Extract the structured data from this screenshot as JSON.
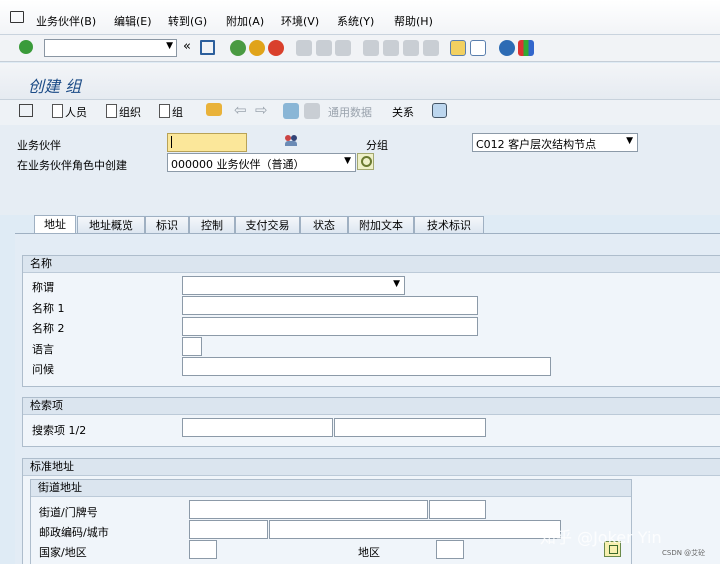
{
  "menubar": {
    "items": [
      "业务伙伴(B)",
      "编辑(E)",
      "转到(G)",
      "附加(A)",
      "环境(V)",
      "系统(Y)",
      "帮助(H)"
    ]
  },
  "page": {
    "title": "创建 组"
  },
  "toolbar": {
    "person": "人员",
    "organization": "组织",
    "group": "组",
    "data_transfer": "通用数据",
    "relationships": "关系"
  },
  "header_form": {
    "partner_label": "业务伙伴",
    "partner_value": "",
    "grouping_label": "分组",
    "grouping_value": "C012 客户层次结构节点",
    "role_label": "在业务伙伴角色中创建",
    "role_value": "000000 业务伙伴（普通）"
  },
  "tabs": [
    "地址",
    "地址概览",
    "标识",
    "控制",
    "支付交易",
    "状态",
    "附加文本",
    "技术标识"
  ],
  "name_group": {
    "title": "名称",
    "salutation_label": "称谓",
    "name1_label": "名称 1",
    "name2_label": "名称 2",
    "language_label": "语言",
    "greeting_label": "问候"
  },
  "search_group": {
    "title": "检索项",
    "search_label": "搜索项 1/2"
  },
  "address_group": {
    "title": "标准地址",
    "street_subgroup_title": "街道地址",
    "street_label": "街道/门牌号",
    "postal_label": "邮政编码/城市",
    "country_label": "国家/地区",
    "region_label": "地区"
  },
  "watermark": "知乎 @Joker Yin",
  "credit": "CSDN @艾砼"
}
